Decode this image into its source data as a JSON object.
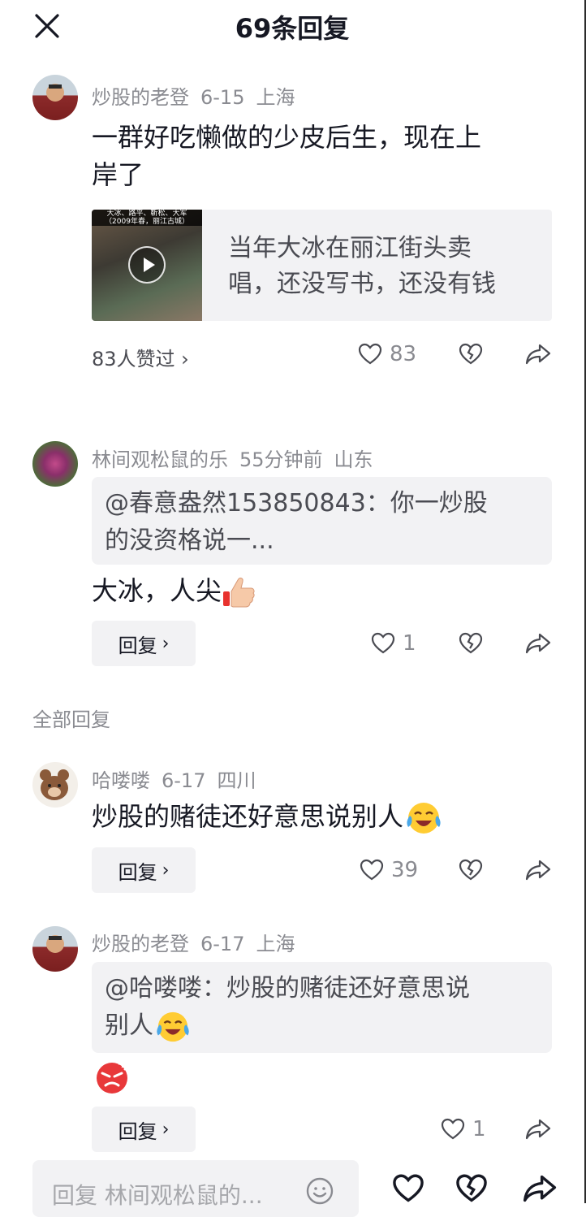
{
  "header": {
    "title": "69条回复"
  },
  "comments": [
    {
      "user": "炒股的老登",
      "date": "6-15",
      "location": "上海",
      "text_line1": "一群好吃懒做的少皮后生，现在上",
      "text_line2": "岸了",
      "video": {
        "caption_line1": "大冰、路平、靳松、大军",
        "caption_line2": "（2009年春，丽江古城）",
        "text_line1": "当年大冰在丽江街头卖",
        "text_line2": "唱，还没写书，还没有钱"
      },
      "likes_summary": "83人赞过",
      "like_count": "83"
    },
    {
      "user": "林间观松鼠的乐",
      "date": "55分钟前",
      "location": "山东",
      "quote_line1": "@春意盎然153850843：你一炒股",
      "quote_line2": "的没资格说一...",
      "text": "大冰，人尖",
      "reply_label": "回复",
      "like_count": "1"
    }
  ],
  "section_label": "全部回复",
  "replies": [
    {
      "user": "哈喽喽",
      "date": "6-17",
      "location": "四川",
      "text": "炒股的赌徒还好意思说别人",
      "reply_label": "回复",
      "like_count": "39"
    },
    {
      "user": "炒股的老登",
      "date": "6-17",
      "location": "上海",
      "quote_line1": "@哈喽喽：炒股的赌徒还好意思说",
      "quote_line2": "别人",
      "reply_label": "回复",
      "like_count": "1"
    }
  ],
  "bottom_bar": {
    "placeholder": "回复 林间观松鼠的..."
  },
  "icons": {
    "close": "close-icon",
    "like": "heart-outline-icon",
    "dislike": "broken-heart-icon",
    "share": "share-arrow-icon",
    "emoji": "smiley-icon"
  },
  "colors": {
    "text": "#161823",
    "muted": "#8a8b91",
    "bubble": "#f2f2f4"
  }
}
